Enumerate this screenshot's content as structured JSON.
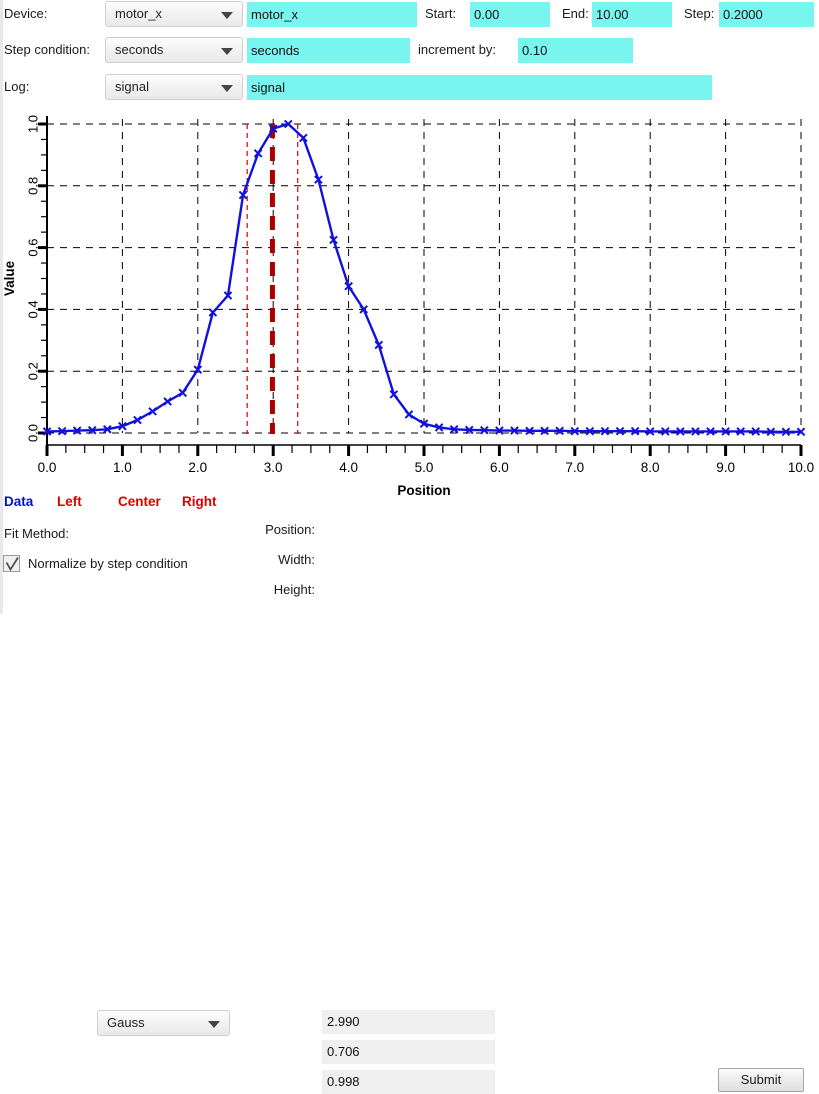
{
  "form": {
    "device": {
      "label": "Device:",
      "combo_value": "motor_x",
      "text_value": "motor_x"
    },
    "start": {
      "label": "Start:",
      "value": "0.00"
    },
    "end": {
      "label": "End:",
      "value": "10.00"
    },
    "step": {
      "label": "Step:",
      "value": "0.2000"
    },
    "step_condition": {
      "label": "Step condition:",
      "combo_value": "seconds",
      "text_value": "seconds"
    },
    "increment": {
      "label": "increment by:",
      "value": "0.10"
    },
    "log": {
      "label": "Log:",
      "combo_value": "signal",
      "text_value": "signal"
    }
  },
  "legend": {
    "data": "Data",
    "left": "Left",
    "center": "Center",
    "right": "Right",
    "data_color": "#0011cc",
    "marker_color": "#dd0000"
  },
  "controls": {
    "fit_method_label": "Fit Method:",
    "fit_method_value": "Gauss",
    "normalize_label": "Normalize by step condition",
    "normalize_checked": true,
    "submit_label": "Submit"
  },
  "results": {
    "position_label": "Position:",
    "position_value": "2.990",
    "width_label": "Width:",
    "width_value": "0.706",
    "height_label": "Height:",
    "height_value": "0.998"
  },
  "chart_data": {
    "type": "line",
    "title": "",
    "xlabel": "Position",
    "ylabel": "Value",
    "xlim": [
      0.0,
      10.0
    ],
    "ylim": [
      0.0,
      1.05
    ],
    "xticks": [
      0.0,
      1.0,
      2.0,
      3.0,
      4.0,
      5.0,
      6.0,
      7.0,
      8.0,
      9.0,
      10.0
    ],
    "xticklabels": [
      "0.0",
      "1.0",
      "2.0",
      "3.0",
      "4.0",
      "5.0",
      "6.0",
      "7.0",
      "8.0",
      "9.0",
      "10.0"
    ],
    "yticks": [
      0.0,
      0.2,
      0.4,
      0.6,
      0.8,
      1.0
    ],
    "yticklabels": [
      "0.0",
      "0.2",
      "0.4",
      "0.6",
      "0.8",
      "1.0"
    ],
    "grid": true,
    "minor_ticks": true,
    "legend_position": "below-axes",
    "series": [
      {
        "name": "Data",
        "color": "#1111dd",
        "marker": "x",
        "x": [
          0.0,
          0.2,
          0.4,
          0.6,
          0.8,
          1.0,
          1.2,
          1.4,
          1.6,
          1.8,
          2.0,
          2.2,
          2.4,
          2.6,
          2.8,
          3.0,
          3.2,
          3.4,
          3.6,
          3.8,
          4.0,
          4.2,
          4.4,
          4.6,
          4.8,
          5.0,
          5.2,
          5.4,
          5.6,
          5.8,
          6.0,
          6.2,
          6.4,
          6.6,
          6.8,
          7.0,
          7.2,
          7.4,
          7.6,
          7.8,
          8.0,
          8.2,
          8.4,
          8.6,
          8.8,
          9.0,
          9.2,
          9.4,
          9.6,
          9.8,
          10.0
        ],
        "y": [
          0.005,
          0.006,
          0.008,
          0.009,
          0.012,
          0.022,
          0.042,
          0.07,
          0.102,
          0.13,
          0.205,
          0.39,
          0.445,
          0.77,
          0.905,
          0.985,
          1.0,
          0.955,
          0.82,
          0.625,
          0.475,
          0.4,
          0.285,
          0.125,
          0.06,
          0.03,
          0.018,
          0.012,
          0.01,
          0.009,
          0.008,
          0.008,
          0.007,
          0.007,
          0.007,
          0.006,
          0.006,
          0.006,
          0.006,
          0.006,
          0.005,
          0.005,
          0.005,
          0.005,
          0.005,
          0.005,
          0.005,
          0.005,
          0.004,
          0.004,
          0.004
        ]
      }
    ],
    "markers": [
      {
        "name": "left",
        "x": 2.655,
        "color": "#dd0000",
        "style": "dashed-thin"
      },
      {
        "name": "center",
        "x": 2.99,
        "color": "#aa0000",
        "style": "dashed-thick"
      },
      {
        "name": "right",
        "x": 3.325,
        "color": "#dd0000",
        "style": "dashed-thin"
      }
    ]
  }
}
